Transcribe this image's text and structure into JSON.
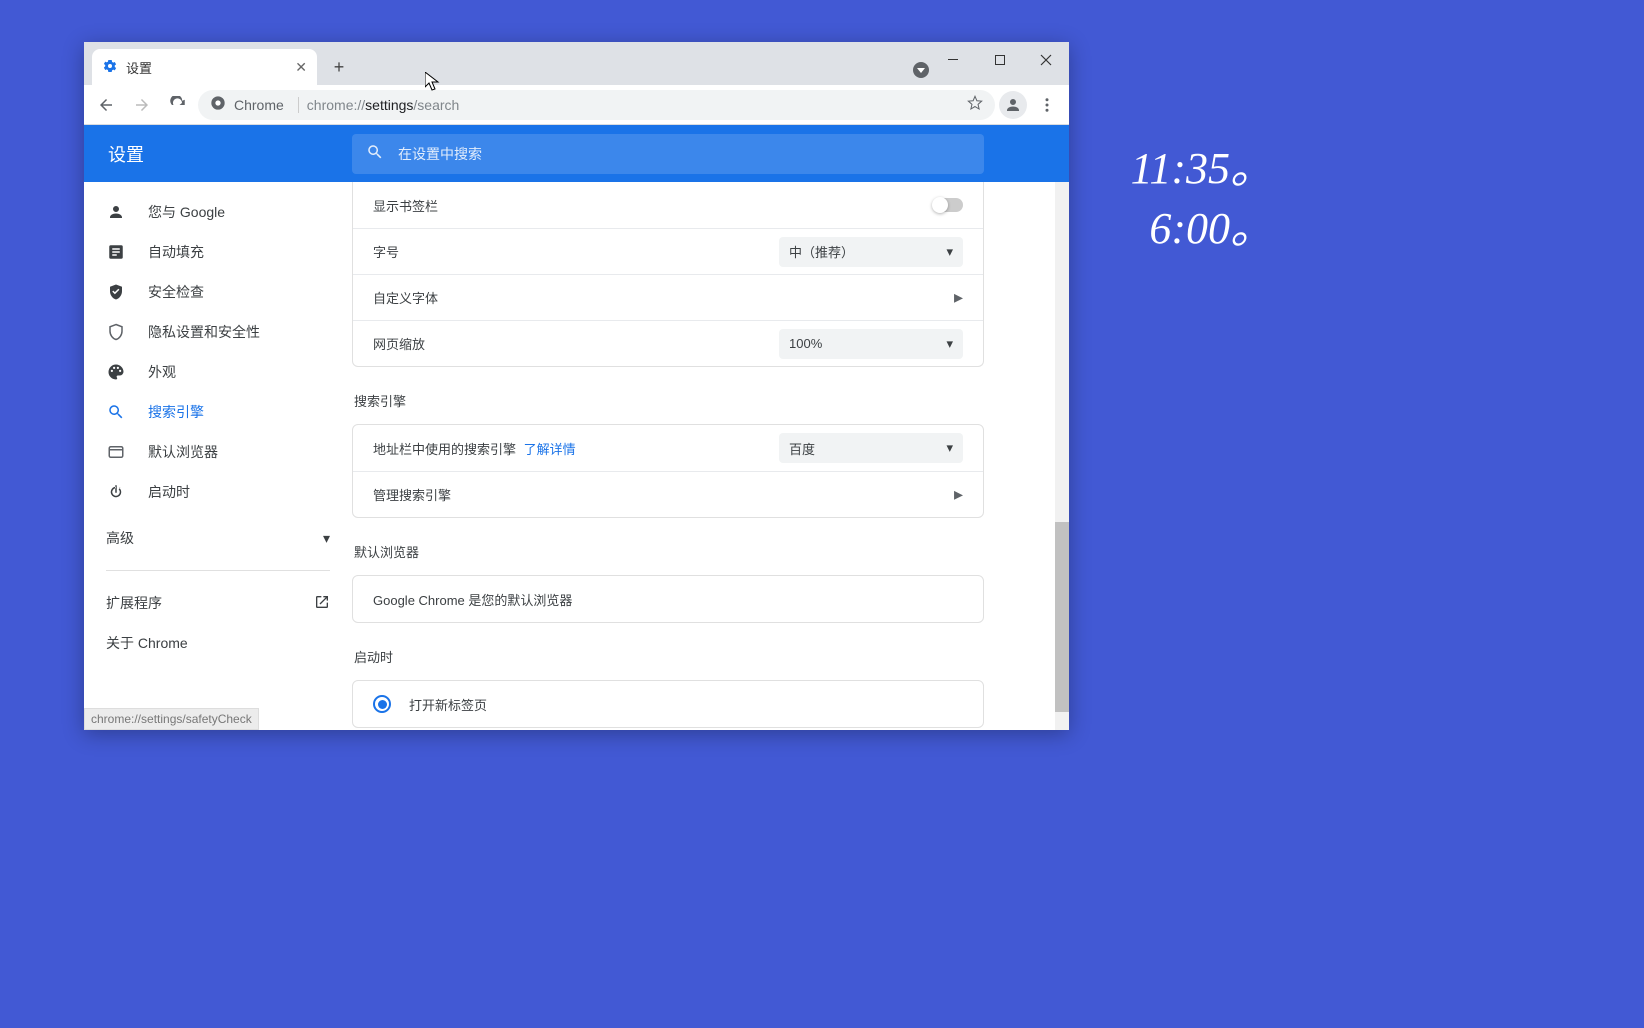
{
  "desktop": {
    "clock1": "11:35。",
    "clock2": "6:00。"
  },
  "tab": {
    "title": "设置"
  },
  "address": {
    "chrome_label": "Chrome",
    "prefix": "chrome://",
    "bold": "settings",
    "suffix": "/search"
  },
  "header": {
    "title": "设置",
    "search_placeholder": "在设置中搜索"
  },
  "sidebar": {
    "items": [
      {
        "label": "您与 Google"
      },
      {
        "label": "自动填充"
      },
      {
        "label": "安全检查"
      },
      {
        "label": "隐私设置和安全性"
      },
      {
        "label": "外观"
      },
      {
        "label": "搜索引擎"
      },
      {
        "label": "默认浏览器"
      },
      {
        "label": "启动时"
      }
    ],
    "advanced": "高级",
    "extensions": "扩展程序",
    "about": "关于 Chrome"
  },
  "appearance": {
    "bookmarks_label": "显示书签栏",
    "font_size_label": "字号",
    "font_size_value": "中（推荐）",
    "custom_fonts_label": "自定义字体",
    "zoom_label": "网页缩放",
    "zoom_value": "100%"
  },
  "search_engine": {
    "section_title": "搜索引擎",
    "row1_label": "地址栏中使用的搜索引擎",
    "row1_link": "了解详情",
    "row1_value": "百度",
    "row2_label": "管理搜索引擎"
  },
  "default_browser": {
    "section_title": "默认浏览器",
    "message": "Google Chrome 是您的默认浏览器"
  },
  "on_startup": {
    "section_title": "启动时",
    "option1": "打开新标签页"
  },
  "status_url": "chrome://settings/safetyCheck"
}
